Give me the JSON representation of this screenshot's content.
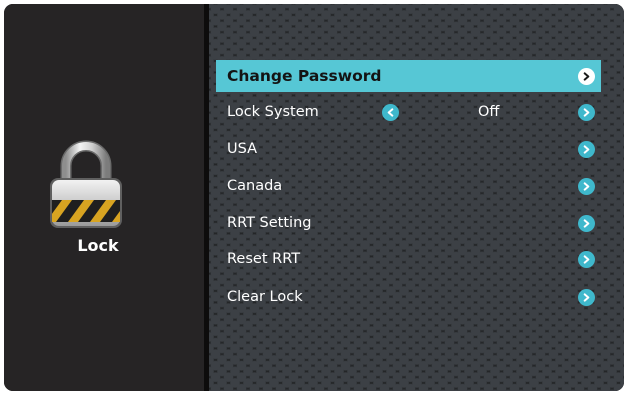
{
  "side_panel": {
    "title": "Lock",
    "icon": "padlock-icon"
  },
  "menu": {
    "items": [
      {
        "label": "Change Password",
        "selected": true
      },
      {
        "label": "Lock System",
        "value": "Off"
      },
      {
        "label": "USA"
      },
      {
        "label": "Canada"
      },
      {
        "label": "RRT Setting"
      },
      {
        "label": "Reset RRT"
      },
      {
        "label": "Clear Lock"
      }
    ]
  },
  "colors": {
    "highlight": "#56c7d5",
    "arrow": "#3fb8cc",
    "panel": "#262425",
    "background": "#242628"
  }
}
